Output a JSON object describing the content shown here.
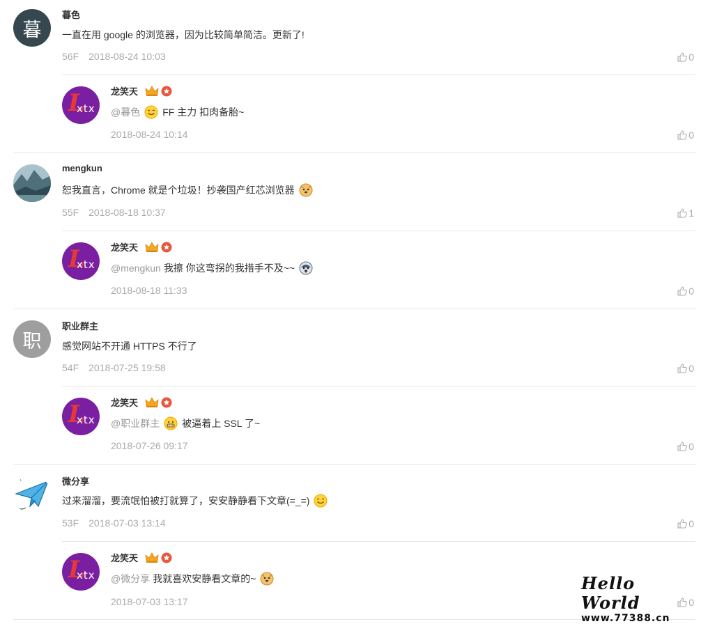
{
  "comments": [
    {
      "avatar_text": "暮",
      "avatar_color": "#37474f",
      "name": "暮色",
      "text": "一直在用 google 的浏览器，因为比较简单简洁。更新了!",
      "floor": "56F",
      "time": "2018-08-24 10:03",
      "likes": "0",
      "reply": {
        "name": "龙笑天",
        "mention": "@暮色",
        "text": "FF 主力 扣肉备胎~",
        "time": "2018-08-24 10:14",
        "likes": "0",
        "emoji": "smile-emoji"
      }
    },
    {
      "avatar_text": "",
      "avatar_color": "#6b8f9e",
      "name": "mengkun",
      "text": "恕我直言，Chrome 就是个垃圾！抄袭国产红芯浏览器",
      "emoji": "doge-emoji",
      "floor": "55F",
      "time": "2018-08-18 10:37",
      "likes": "1",
      "reply": {
        "name": "龙笑天",
        "mention": "@mengkun",
        "text": "我擦 你这弯拐的我措手不及~~",
        "time": "2018-08-18 11:33",
        "likes": "0",
        "emoji": "husky-emoji"
      }
    },
    {
      "avatar_text": "职",
      "avatar_color": "#9e9e9e",
      "name": "职业群主",
      "text": "感觉网站不开通 HTTPS 不行了",
      "floor": "54F",
      "time": "2018-07-25 19:58",
      "likes": "0",
      "reply": {
        "name": "龙笑天",
        "mention": "@职业群主",
        "text": "被逼着上 SSL 了~",
        "time": "2018-07-26 09:17",
        "likes": "0",
        "emoji": "grin-emoji"
      }
    },
    {
      "avatar_text": "",
      "avatar_color": "#ffffff",
      "name": "微分享",
      "text": "过来溜溜，要流氓怕被打就算了，安安静静看下文章(=_=)",
      "emoji": "smile-emoji",
      "floor": "53F",
      "time": "2018-07-03 13:14",
      "likes": "0",
      "reply": {
        "name": "龙笑天",
        "mention": "@微分享",
        "text": "我就喜欢安静看文章的~",
        "time": "2018-07-03 13:17",
        "likes": "0",
        "emoji": "doge-emoji"
      }
    }
  ],
  "watermark": {
    "title": "Hello World",
    "url": "www.77388.cn"
  },
  "colors": {
    "reply_avatar": "#7b1fa2",
    "muted": "#aaaaaa",
    "divider": "#e5e5e5",
    "badge_red": "#e8553b",
    "crown": "#f5a623"
  }
}
